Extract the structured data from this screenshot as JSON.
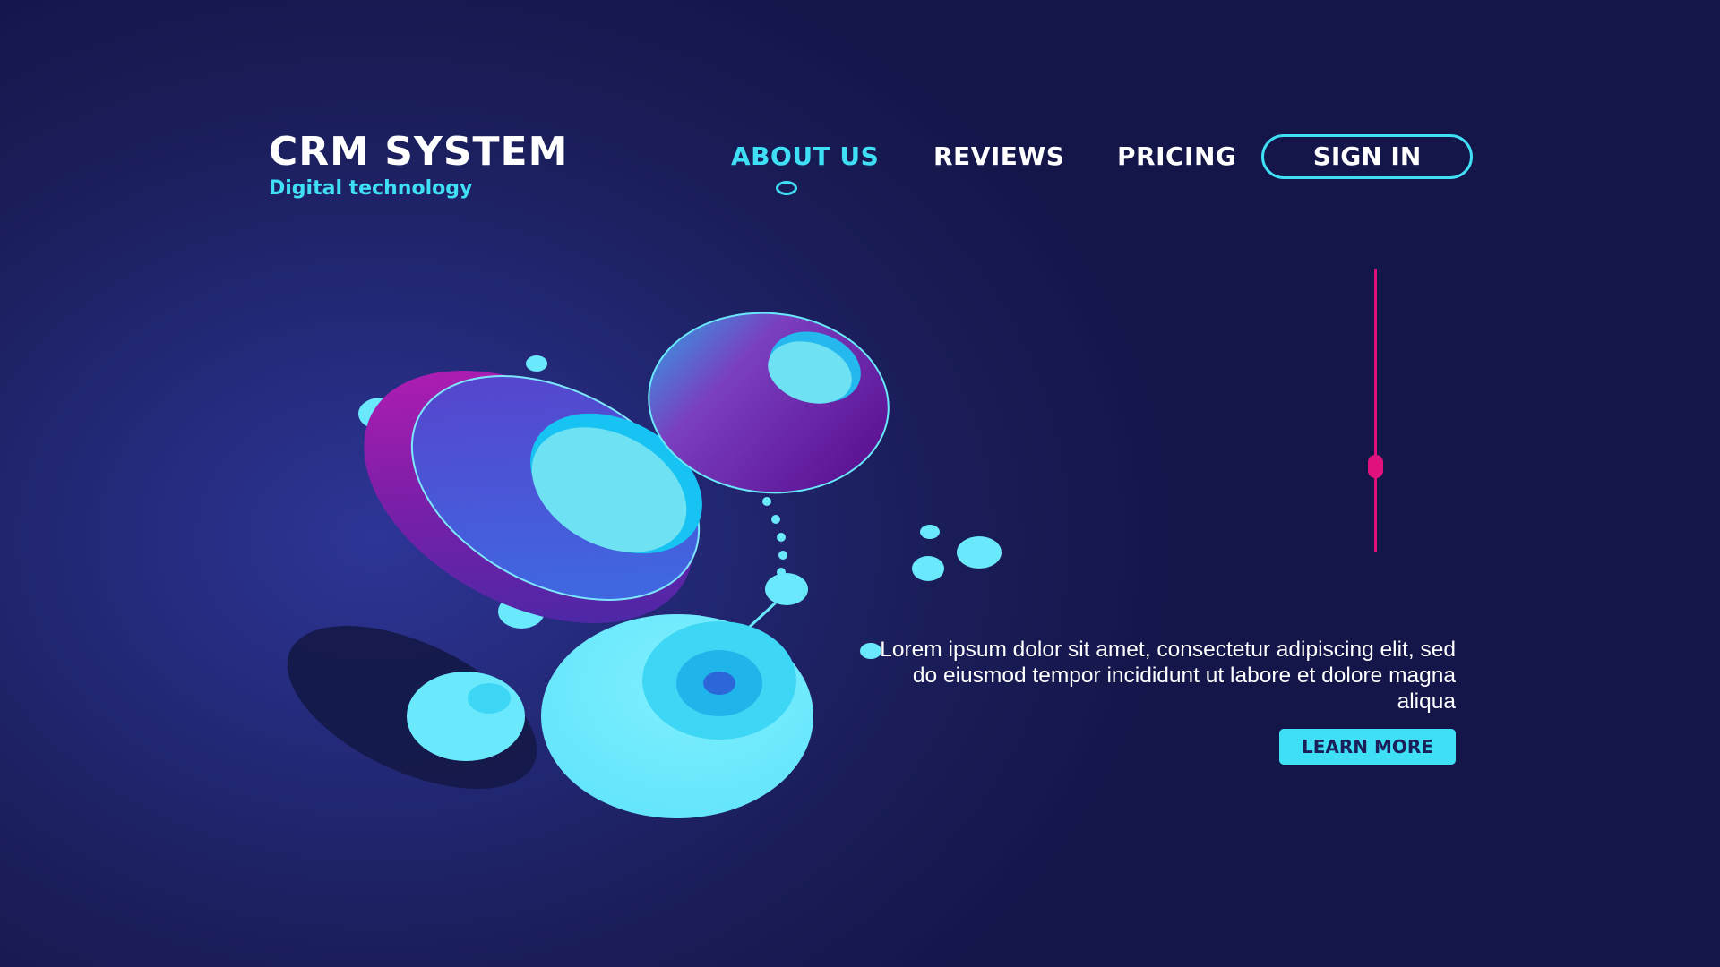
{
  "brand": {
    "title": "CRM SYSTEM",
    "subtitle": "Digital technology"
  },
  "nav": {
    "items": [
      {
        "label": "ABOUT US",
        "active": true
      },
      {
        "label": "REVIEWS",
        "active": false
      },
      {
        "label": "PRICING",
        "active": false
      }
    ],
    "sign_in_label": "SIGN IN"
  },
  "hero": {
    "body": "Lorem ipsum dolor sit amet, consectetur adipiscing elit, sed do eiusmod tempor incididunt ut labore et dolore magna aliqua",
    "cta_label": "LEARN MORE"
  },
  "colors": {
    "background": "#1a1d58",
    "accent_cyan": "#3fe0f5",
    "accent_magenta": "#e0117d",
    "purple": "#7a1fa8"
  }
}
